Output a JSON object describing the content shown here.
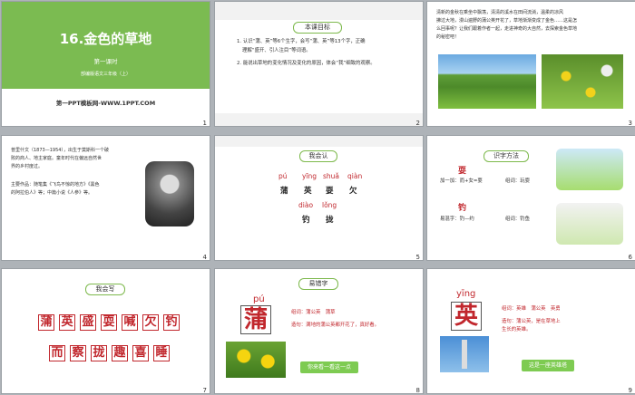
{
  "slides": [
    {
      "num": "1",
      "title": "16.金色的草地",
      "subtitle": "第一课时",
      "grade": "部编版语文三年级（上）",
      "footer": "第一PPT模板网-WWW.1PPT.COM"
    },
    {
      "num": "2",
      "pill": "本课目标",
      "lines": [
        "1. 认识“蒲、英”等6个生字，会写“蒲、英”等13个字，正确",
        "理解“盛开、引人注目”等词语。",
        "2. 能说出草地的变化情况及变化的原因，体会“我”细致的观察。"
      ]
    },
    {
      "num": "3",
      "lines": [
        "  清新的金秋在乘坐中飘荡，清清的溪水在田间流淌，温柔的凉风",
        "拂过大地，漫山遍野的蒲公英开花了，草地渐渐变成了金色……这是怎",
        "么回事呢？让我们跟着作者一起，走进神奇的大自然，去探索金色草地",
        "的秘密吧！"
      ]
    },
    {
      "num": "4",
      "lines": [
        "普里什文（1873—1954），出生于莫斯科一个破",
        "败的商人、地主家庭。童年时代在偏远自然世",
        "界的乡村度过。",
        "",
        "主要作品：随笔集《飞鸟不惊的地方》《黑色",
        "的阿拉伯人》等；中篇小说《人参》等。"
      ]
    },
    {
      "num": "5",
      "pill": "我会认",
      "pinyin1": [
        "pú",
        "yīng",
        "shuǎ",
        "qiàn"
      ],
      "chars1": [
        "蒲",
        "英",
        "耍",
        "欠"
      ],
      "pinyin2": [
        "diào",
        "lǒng"
      ],
      "chars2": [
        "钓",
        "拢"
      ]
    },
    {
      "num": "6",
      "pill": "识字方法",
      "c1": "耍",
      "f1": "加一加：而+女=耍",
      "w1": "组词：玩耍",
      "c2": "钓",
      "f2": "易混字：钓—约",
      "w2": "组词：钓鱼"
    },
    {
      "num": "7",
      "pill": "我会写",
      "row1": [
        "蒲",
        "英",
        "盛",
        "耍",
        "喊",
        "欠",
        "钓"
      ],
      "row2": [
        "而",
        "察",
        "拢",
        "趣",
        "喜",
        "睡"
      ]
    },
    {
      "num": "8",
      "pill": "易错字",
      "pinyin": "pú",
      "char": "蒲",
      "word": "组词：蒲公英　蒲草",
      "sent": "造句：满地的蒲公英都开花了，真好看。",
      "btn": "你来看一看这一点"
    },
    {
      "num": "9",
      "pinyin": "yīng",
      "char": "英",
      "word": "组词：英雄　蒲公英　英勇",
      "sent1": "造句：蒲公英，是在草地上",
      "sent2": "生长的英雄。",
      "btn": "这是一座英雄塔"
    }
  ]
}
